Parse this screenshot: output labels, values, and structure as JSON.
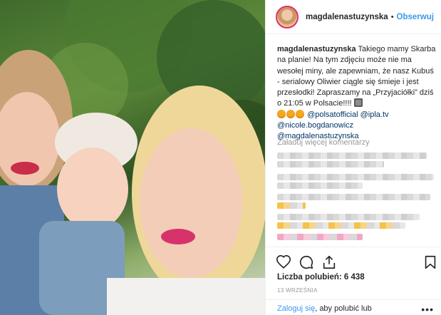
{
  "header": {
    "username": "magdalenastuzynska",
    "dot": "•",
    "follow_label": "Obserwuj"
  },
  "caption": {
    "username": "magdalenastuzynska",
    "text_1": "Takiego mamy Skarba na planie! Na tym zdjęciu może nie ma wesołej miny, ale zapewniam, że nasz Kubuś - serialowy Oliwier ciągle się śmieje i jest przesłodki! Zapraszamy na „Przyjaciółki” dziś o 21:05 w Polsacie!!!!",
    "mention_1": "@polsatofficial",
    "mention_2": "@ipla.tv",
    "mention_3": "@nicole.bogdanowicz",
    "mention_4": "@magdalenastuzynska"
  },
  "comments": {
    "load_more_label": "Załaduj więcej komentarzy"
  },
  "actions": {
    "like_icon": "heart-icon",
    "comment_icon": "comment-icon",
    "share_icon": "share-icon",
    "save_icon": "bookmark-icon"
  },
  "likes": {
    "label": "Liczba polubień: 6 438"
  },
  "date": "13 WRZEŚNIA",
  "login": {
    "link_label": "Zaloguj się",
    "text": ", aby polubić lub"
  },
  "more_label": "•••",
  "colors": {
    "link": "#3897f0",
    "text": "#262626",
    "muted": "#999999",
    "mention": "#003569"
  }
}
